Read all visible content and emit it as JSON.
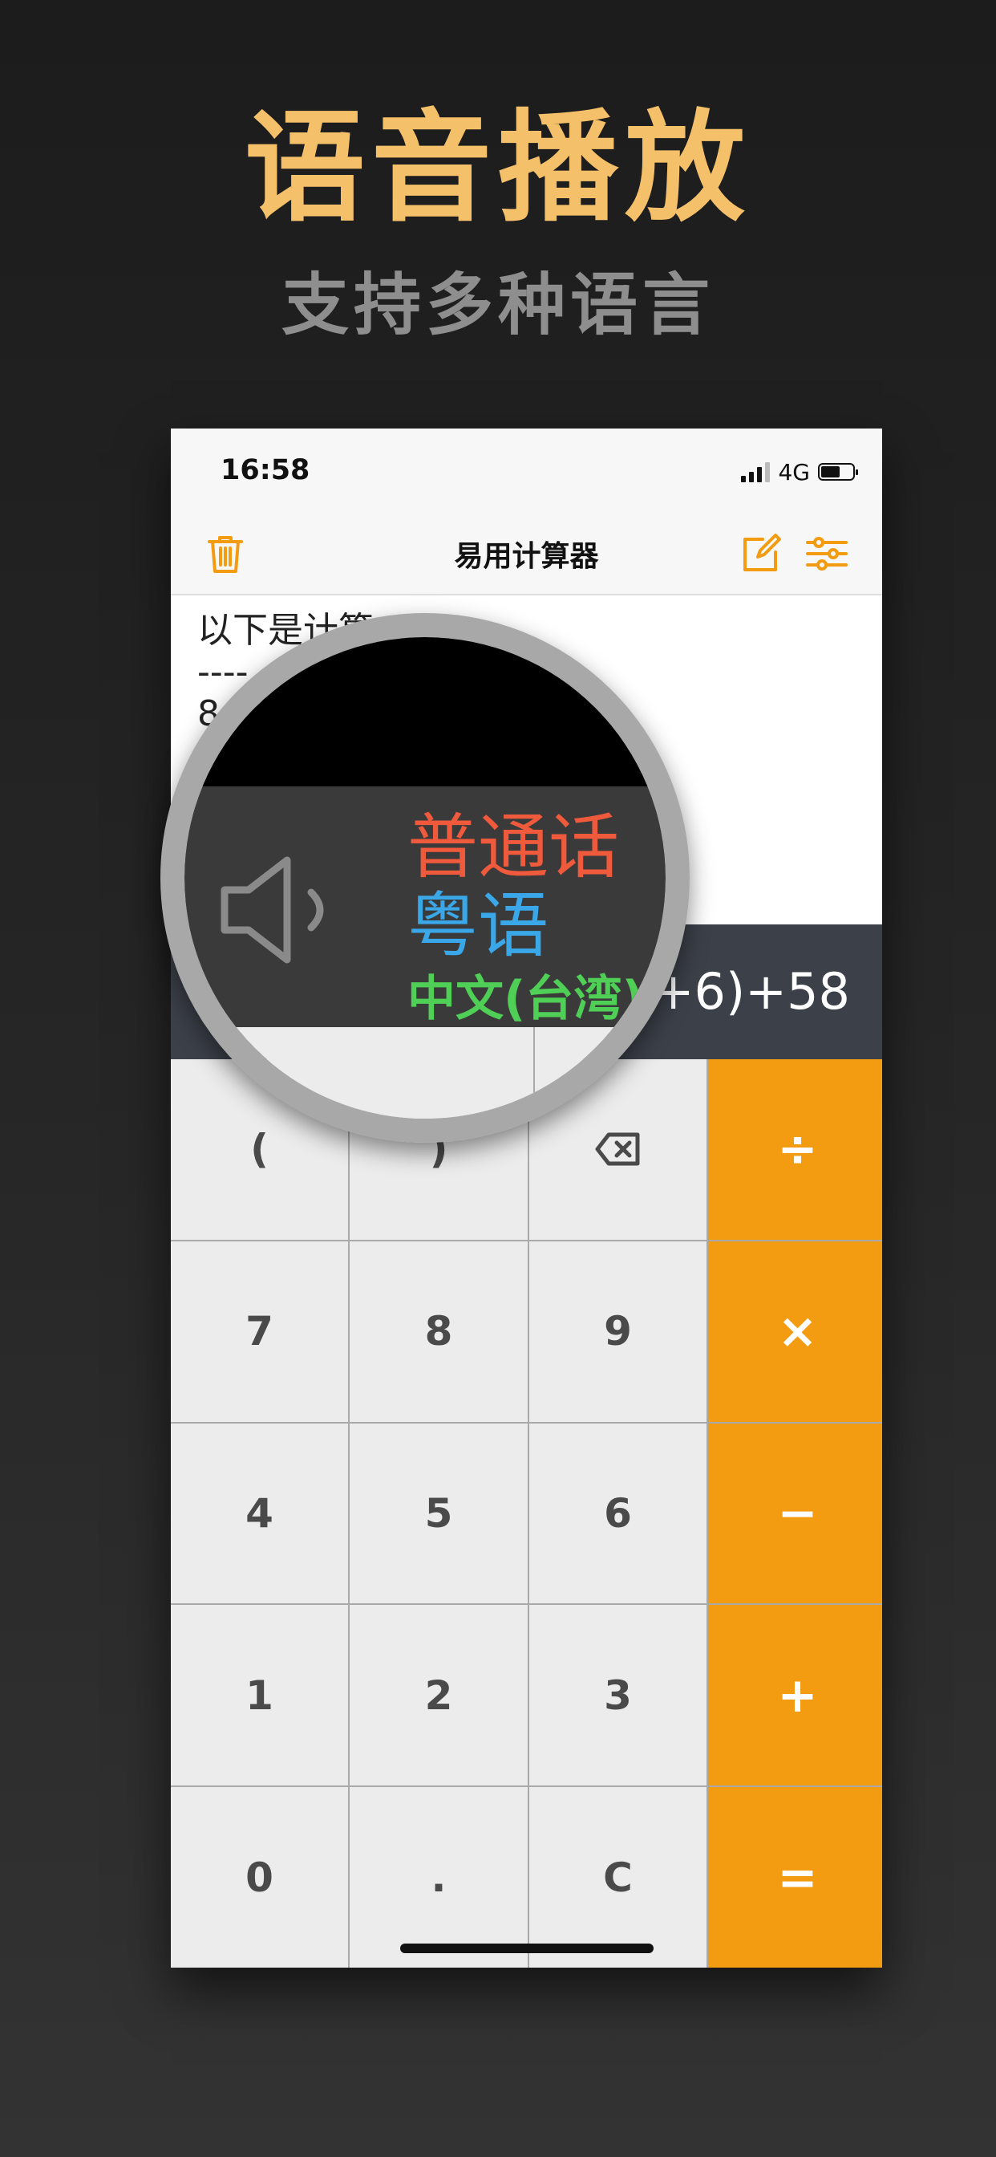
{
  "promo": {
    "headline": "语音播放",
    "subline": "支持多种语言"
  },
  "status_bar": {
    "time": "16:58",
    "network": "4G",
    "battery_level": 0.6
  },
  "nav": {
    "title": "易用计算器",
    "icons": {
      "left": "trash-icon",
      "right": [
        "edit-icon",
        "settings-sliders-icon"
      ]
    }
  },
  "history": {
    "lines": [
      "以下是计算",
      "----",
      "8"
    ]
  },
  "display": {
    "expression": "+6)+58"
  },
  "keypad": {
    "rows": [
      [
        "(",
        ")",
        "backspace-icon",
        "÷"
      ],
      [
        "7",
        "8",
        "9",
        "×"
      ],
      [
        "4",
        "5",
        "6",
        "−"
      ],
      [
        "1",
        "2",
        "3",
        "+"
      ],
      [
        "0",
        ".",
        "C",
        "="
      ]
    ]
  },
  "magnifier": {
    "languages": [
      "普通话",
      "粤语",
      "中文(台湾)"
    ],
    "icon": "speaker-icon"
  },
  "colors": {
    "accent_orange": "#f39c12",
    "headline_gold": "#f5c06a",
    "mandarin_red": "#f05a3c",
    "cantonese_blue": "#3aa7e8",
    "taiwan_green": "#4fcf56"
  }
}
